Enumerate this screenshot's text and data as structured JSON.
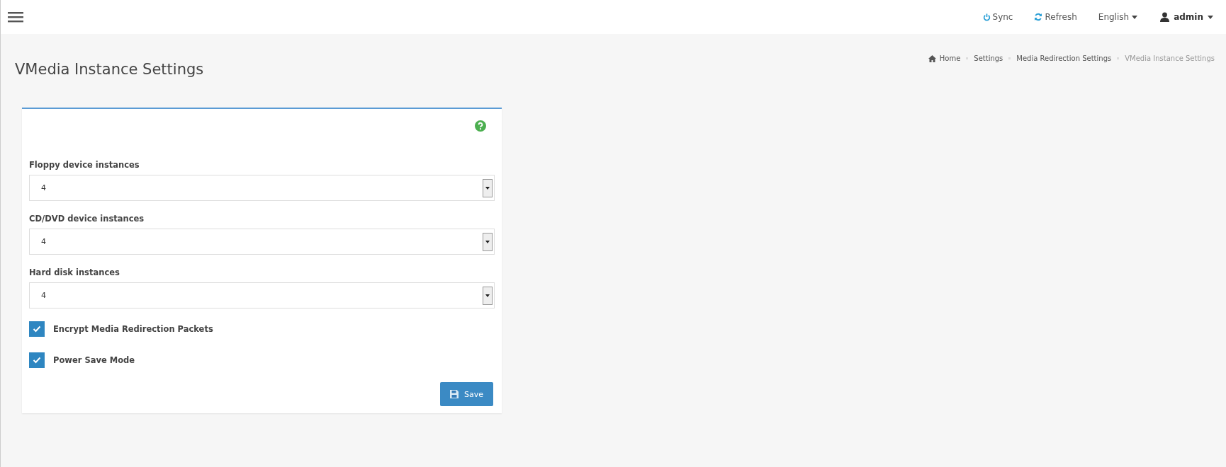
{
  "topbar": {
    "actions": [
      {
        "kind": "sync",
        "label": "Sync"
      },
      {
        "kind": "refresh",
        "label": "Refresh"
      },
      {
        "kind": "language",
        "label": "English"
      },
      {
        "kind": "user",
        "label": "admin"
      }
    ]
  },
  "page": {
    "title": "VMedia Instance Settings"
  },
  "breadcrumb": [
    {
      "label": "Home",
      "current": false
    },
    {
      "label": "Settings",
      "current": false
    },
    {
      "label": "Media Redirection Settings",
      "current": false
    },
    {
      "label": "VMedia Instance Settings",
      "current": true
    }
  ],
  "form": {
    "fields": [
      {
        "label": "Floppy device instances",
        "value": "4"
      },
      {
        "label": "CD/DVD device instances",
        "value": "4"
      },
      {
        "label": "Hard disk instances",
        "value": "4"
      }
    ],
    "checkboxes": [
      {
        "label": "Encrypt Media Redirection Packets",
        "checked": true
      },
      {
        "label": "Power Save Mode",
        "checked": true
      }
    ],
    "save_button": "Save"
  }
}
